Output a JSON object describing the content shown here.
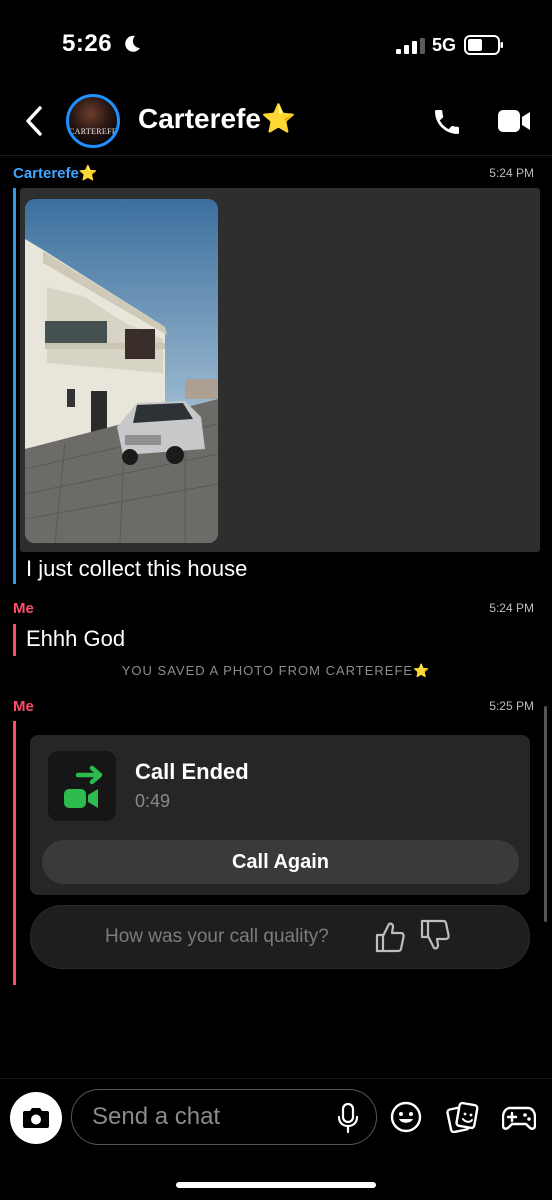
{
  "status_bar": {
    "time": "5:26",
    "network": "5G"
  },
  "header": {
    "contact_name": "Carterefe⭐",
    "avatar_text": "CARTEREFE"
  },
  "messages": [
    {
      "sender": "Carterefe⭐",
      "time": "5:24 PM",
      "text": "I just collect this house"
    },
    {
      "sender": "Me",
      "time": "5:24 PM",
      "text": "Ehhh God"
    }
  ],
  "saved_note": "YOU SAVED A PHOTO FROM CARTEREFE⭐",
  "call": {
    "sender": "Me",
    "time": "5:25 PM",
    "title": "Call Ended",
    "duration": "0:49",
    "call_again_label": "Call Again",
    "quality_question": "How was your call quality?"
  },
  "composer": {
    "placeholder": "Send a chat"
  },
  "colors": {
    "friend": "#3ea6ff",
    "me": "#ff4d6a",
    "call_green": "#2dbb4e"
  },
  "icons": [
    "moon-icon",
    "signal-icon",
    "battery-icon",
    "back-icon",
    "phone-icon",
    "video-icon",
    "video-call-icon",
    "thumbs-up-icon",
    "thumbs-down-icon",
    "camera-icon",
    "mic-icon",
    "emoji-icon",
    "sticker-icon",
    "game-icon"
  ]
}
